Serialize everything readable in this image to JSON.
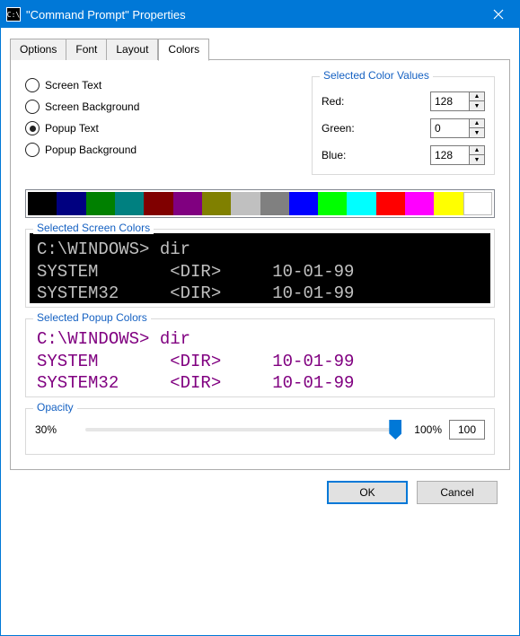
{
  "window": {
    "title": "\"Command Prompt\" Properties",
    "icon": "cmd-icon"
  },
  "tabs": [
    {
      "label": "Options",
      "active": false
    },
    {
      "label": "Font",
      "active": false
    },
    {
      "label": "Layout",
      "active": false
    },
    {
      "label": "Colors",
      "active": true
    }
  ],
  "color_targets": {
    "items": [
      {
        "label": "Screen Text",
        "checked": false
      },
      {
        "label": "Screen Background",
        "checked": false
      },
      {
        "label": "Popup Text",
        "checked": true
      },
      {
        "label": "Popup Background",
        "checked": false
      }
    ]
  },
  "rgb": {
    "legend": "Selected Color Values",
    "red": {
      "label": "Red:",
      "value": "128"
    },
    "green": {
      "label": "Green:",
      "value": "0"
    },
    "blue": {
      "label": "Blue:",
      "value": "128"
    }
  },
  "palette": [
    "#000000",
    "#000080",
    "#008000",
    "#008080",
    "#800000",
    "#800080",
    "#808000",
    "#c0c0c0",
    "#808080",
    "#0000ff",
    "#00ff00",
    "#00ffff",
    "#ff0000",
    "#ff00ff",
    "#ffff00",
    "#ffffff"
  ],
  "screen_preview": {
    "legend": "Selected Screen Colors",
    "text": "C:\\WINDOWS> dir\nSYSTEM       <DIR>     10-01-99\nSYSTEM32     <DIR>     10-01-99"
  },
  "popup_preview": {
    "legend": "Selected Popup Colors",
    "text": "C:\\WINDOWS> dir\nSYSTEM       <DIR>     10-01-99\nSYSTEM32     <DIR>     10-01-99"
  },
  "opacity": {
    "legend": "Opacity",
    "min_label": "30%",
    "max_label": "100%",
    "value": "100"
  },
  "buttons": {
    "ok": "OK",
    "cancel": "Cancel"
  }
}
